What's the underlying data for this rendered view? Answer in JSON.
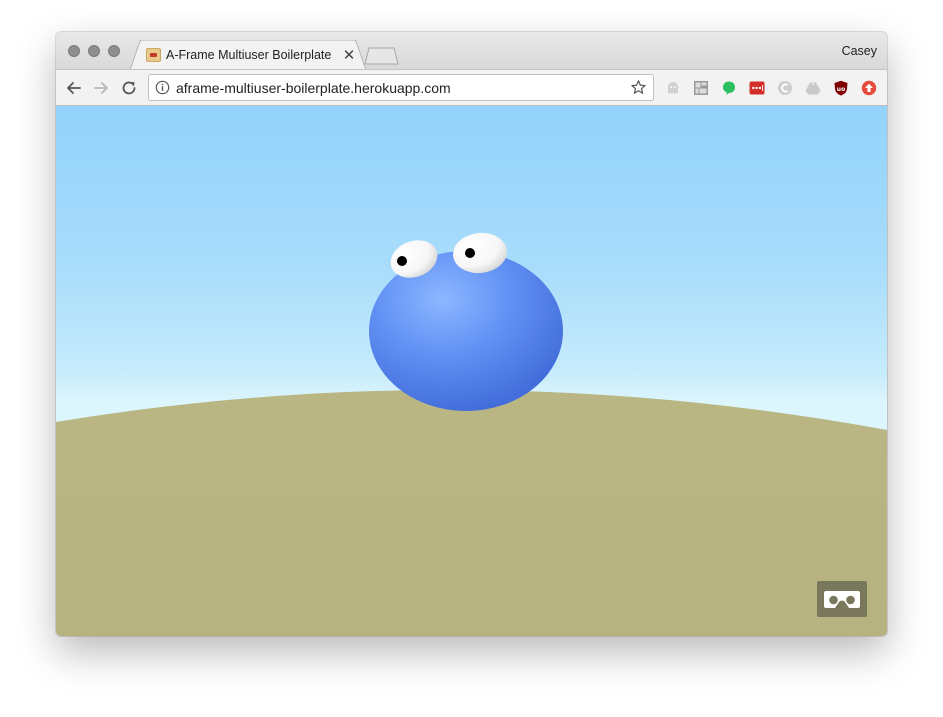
{
  "browser": {
    "tab_title": "A-Frame Multiuser Boilerplate",
    "profile_name": "Casey",
    "url": "aframe-multiuser-boilerplate.herokuapp.com",
    "extensions": [
      "ghostery-icon",
      "grid-extension-icon",
      "evernote-icon",
      "lastpass-icon",
      "circle-extension-icon",
      "google-drive-icon",
      "ublock-origin-icon",
      "update-arrow-icon"
    ]
  },
  "scene": {
    "sky_color": "#9fd8fb",
    "ground_color": "#b8b583",
    "avatar_color": "#5b8def",
    "vr_button_icon": "vr-headset-icon"
  }
}
